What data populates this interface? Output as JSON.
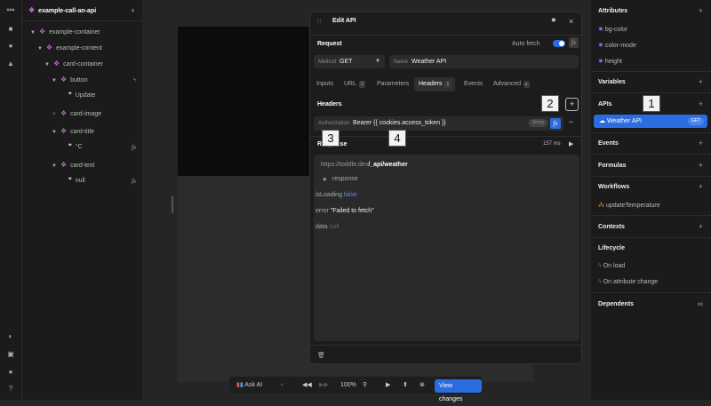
{
  "left_panel": {
    "title": "example-call-an-api",
    "tree": [
      {
        "label": "example-container",
        "type": "element"
      },
      {
        "label": "example-content",
        "type": "element"
      },
      {
        "label": "card-container",
        "type": "element"
      },
      {
        "label": "button",
        "type": "element"
      },
      {
        "label": "Update",
        "type": "text"
      },
      {
        "label": "card-image",
        "type": "element"
      },
      {
        "label": "card-title",
        "type": "element"
      },
      {
        "label": "°C",
        "type": "text"
      },
      {
        "label": "card-text",
        "type": "element"
      },
      {
        "label": "null",
        "type": "text"
      }
    ]
  },
  "dialog": {
    "title": "Edit API",
    "request_label": "Request",
    "auto_fetch_label": "Auto fetch",
    "auto_fetch": true,
    "method_label": "Method",
    "method": "GET",
    "name_label": "Name",
    "name": "Weather API",
    "tabs": [
      {
        "label": "Inputs"
      },
      {
        "label": "URL",
        "count": "2"
      },
      {
        "label": "Parameters"
      },
      {
        "label": "Headers",
        "count": "1"
      },
      {
        "label": "Events"
      },
      {
        "label": "Advanced",
        "count": "▸"
      }
    ],
    "headers_label": "Headers",
    "header_key": "Authorization",
    "header_value": "Bearer {{ cookies.access_token }}",
    "header_type": "String",
    "response_label": "Response",
    "response_time": "157 ms",
    "url_base": "https://toddle.dev",
    "url_path": "/_api/weather",
    "response_key": "response",
    "is_loading_key": "isLoading",
    "is_loading_val": "false",
    "error_key": "error",
    "error_val": "\"Failed to fetch\"",
    "data_key": "data",
    "data_val": "null"
  },
  "annotations": [
    "1",
    "2",
    "3",
    "4"
  ],
  "right_panel": {
    "attributes": "Attributes",
    "attr_items": [
      "bg-color",
      "color-mode",
      "height"
    ],
    "variables": "Variables",
    "apis": "APIs",
    "api_item": "Weather API",
    "api_method": "GET",
    "events": "Events",
    "formulas": "Formulas",
    "workflows": "Workflows",
    "workflow_item": "updateTemperature",
    "contexts": "Contexts",
    "lifecycle": "Lifecycle",
    "lifecycle_items": [
      "On load",
      "On attribute change"
    ],
    "dependents": "Dependents"
  },
  "bottom_bar": {
    "ask_ai": "Ask AI",
    "zoom": "100%",
    "view_changes": "View changes"
  },
  "colors": {
    "accent": "#2b6ce0",
    "element": "#c45ed6"
  }
}
